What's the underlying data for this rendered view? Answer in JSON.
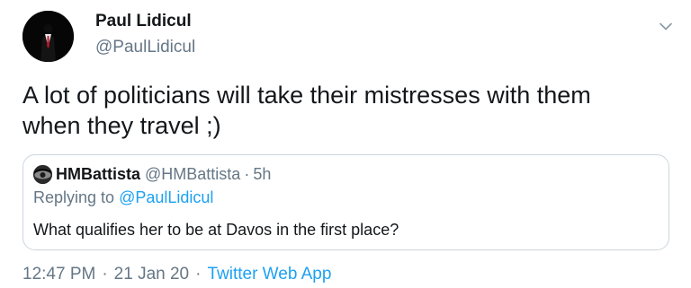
{
  "author": {
    "display_name": "Paul Lidicul",
    "handle": "@PaulLidicul",
    "avatar_icon": "suited-figure-avatar"
  },
  "tweet": {
    "text_line1": "A lot of politicians will take their mistresses with them",
    "text_line2": "when they travel ;)"
  },
  "quoted_tweet": {
    "display_name": "HMBattista",
    "handle": "@HMBattista",
    "separator": "·",
    "time": "5h",
    "replying_prefix": "Replying to ",
    "replying_mention": "@PaulLidicul",
    "text": "What qualifies her to be at Davos in the first place?"
  },
  "meta": {
    "time": "12:47 PM",
    "separator": "·",
    "date": "21 Jan 20",
    "source": "Twitter Web App"
  },
  "colors": {
    "text": "#14171a",
    "secondary": "#657786",
    "accent": "#1da1f2",
    "border": "#ccd6dd"
  }
}
